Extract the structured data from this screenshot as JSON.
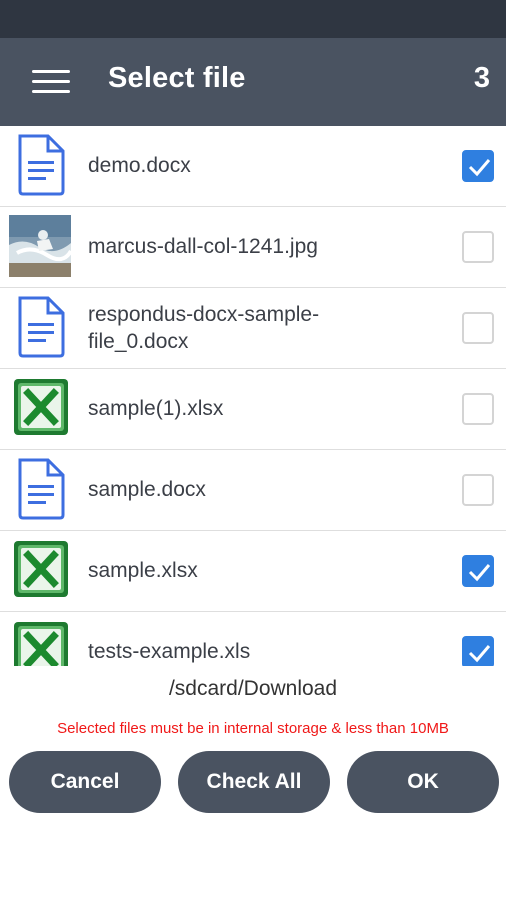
{
  "colors": {
    "accent": "#2f7fe0",
    "app_bar": "#4a5361",
    "status_bar": "#2f3641",
    "warning": "#f01818"
  },
  "header": {
    "title": "Select file",
    "selected_count": "3",
    "menu_icon": "hamburger-menu-icon"
  },
  "files": [
    {
      "name": "demo.docx",
      "type": "docx",
      "icon": "document-icon",
      "checked": true
    },
    {
      "name": "marcus-dall-col-1241.jpg",
      "type": "jpg",
      "icon": "image-thumbnail",
      "checked": false
    },
    {
      "name": "respondus-docx-sample-file_0.docx",
      "line1": "respondus-docx-sample-",
      "line2": "file_0.docx",
      "type": "docx",
      "icon": "document-icon",
      "checked": false
    },
    {
      "name": "sample(1).xlsx",
      "type": "xlsx",
      "icon": "excel-icon",
      "checked": false
    },
    {
      "name": "sample.docx",
      "type": "docx",
      "icon": "document-icon",
      "checked": false
    },
    {
      "name": "sample.xlsx",
      "type": "xlsx",
      "icon": "excel-icon",
      "checked": true
    },
    {
      "name": "tests-example.xls",
      "type": "xls",
      "icon": "excel-icon",
      "checked": true
    }
  ],
  "footer": {
    "path": "/sdcard/Download",
    "warning": "Selected files must be in internal storage & less than 10MB",
    "cancel_label": "Cancel",
    "check_all_label": "Check All",
    "ok_label": "OK"
  }
}
